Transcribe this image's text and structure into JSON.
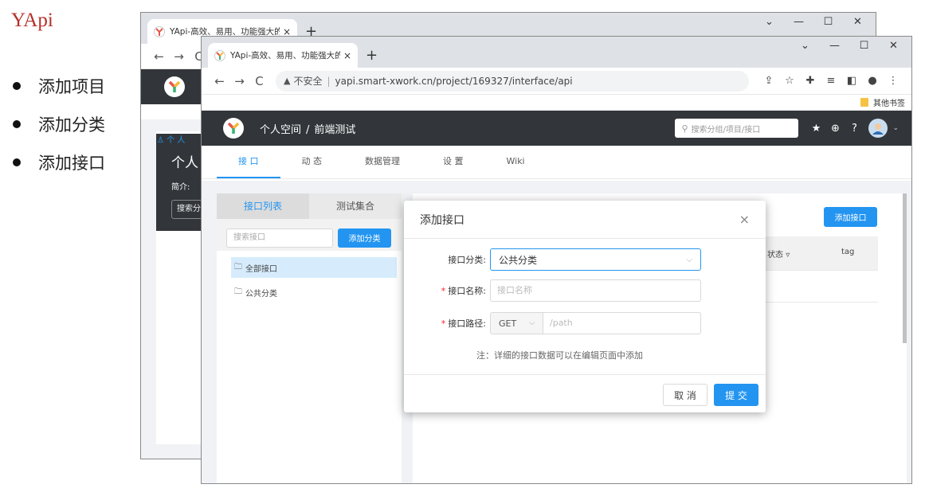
{
  "slide": {
    "title": "YApi",
    "bullets": [
      "添加项目",
      "添加分类",
      "添加接口"
    ]
  },
  "browser": {
    "tab_title": "YApi-高效、易用、功能强大的可",
    "tab_close": "×",
    "new_tab": "+",
    "win_min": "—",
    "win_max": "☐",
    "win_close": "✕",
    "win_menu": "⌄",
    "not_secure": "不安全",
    "url": "yapi.smart-xwork.cn/project/169327/interface/api",
    "bookmark": "其他书签"
  },
  "app": {
    "breadcrumb_space": "个人空间",
    "breadcrumb_sep": "/",
    "breadcrumb_project": "前端测试",
    "search_placeholder": "搜索分组/项目/接口",
    "nav_tabs": [
      "接 口",
      "动 态",
      "数据管理",
      "设 置",
      "Wiki"
    ],
    "left_tabs": [
      "接口列表",
      "测试集合"
    ],
    "left_search_placeholder": "搜索接口",
    "add_category_btn": "添加分类",
    "tree": [
      "全部接口",
      "公共分类"
    ],
    "add_api_btn": "添加接口",
    "col_status": "状态",
    "col_tag": "tag"
  },
  "modal": {
    "title": "添加接口",
    "close": "×",
    "label_category": "接口分类:",
    "category_value": "公共分类",
    "label_name": "接口名称:",
    "name_placeholder": "接口名称",
    "label_path": "接口路径:",
    "method": "GET",
    "path_placeholder": "/path",
    "required_mark": "*",
    "note": "注：详细的接口数据可以在编辑页面中添加",
    "cancel": "取 消",
    "submit": "提 交"
  },
  "back_window": {
    "title": "个人",
    "intro": "简介:",
    "search": "搜索分",
    "user": "个 人"
  },
  "colors": {
    "accent": "#2395f1",
    "header": "#32363a",
    "slide_title": "#b5312b"
  }
}
